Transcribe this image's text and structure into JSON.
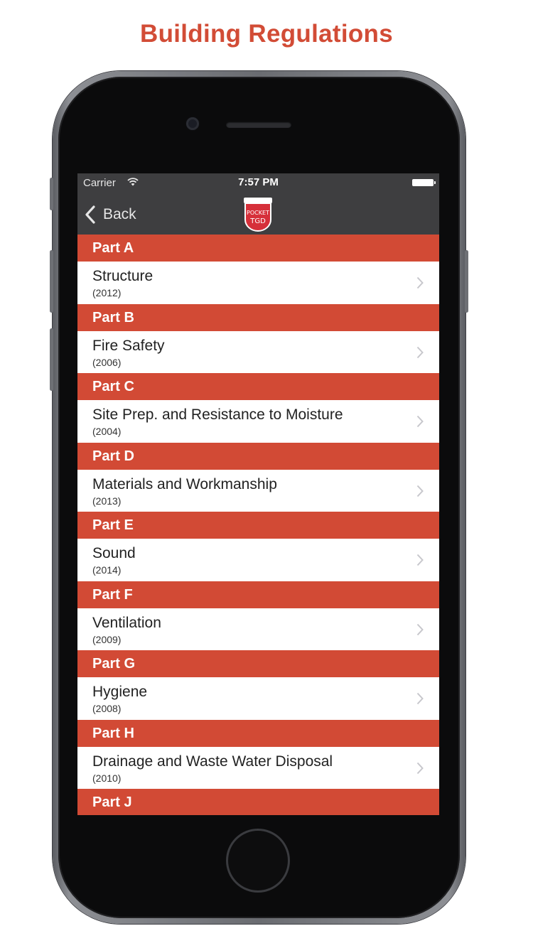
{
  "page": {
    "title": "Building Regulations"
  },
  "status_bar": {
    "carrier": "Carrier",
    "time": "7:57 PM"
  },
  "nav": {
    "back_label": "Back",
    "logo": {
      "text_line1": "POCKET",
      "text_line2": "TGD"
    }
  },
  "theme": {
    "accent": "#d24a35",
    "nav_bg": "#3e3e40",
    "title_color": "#d24c36"
  },
  "sections": [
    {
      "header": "Part A",
      "title": "Structure",
      "year": "(2012)"
    },
    {
      "header": "Part B",
      "title": "Fire Safety",
      "year": "(2006)"
    },
    {
      "header": "Part C",
      "title": "Site Prep. and Resistance to Moisture",
      "year": "(2004)"
    },
    {
      "header": "Part D",
      "title": "Materials and Workmanship",
      "year": "(2013)"
    },
    {
      "header": "Part E",
      "title": "Sound",
      "year": "(2014)"
    },
    {
      "header": "Part F",
      "title": "Ventilation",
      "year": "(2009)"
    },
    {
      "header": "Part G",
      "title": "Hygiene",
      "year": "(2008)"
    },
    {
      "header": "Part H",
      "title": "Drainage and Waste Water Disposal",
      "year": "(2010)"
    },
    {
      "header": "Part J"
    }
  ]
}
